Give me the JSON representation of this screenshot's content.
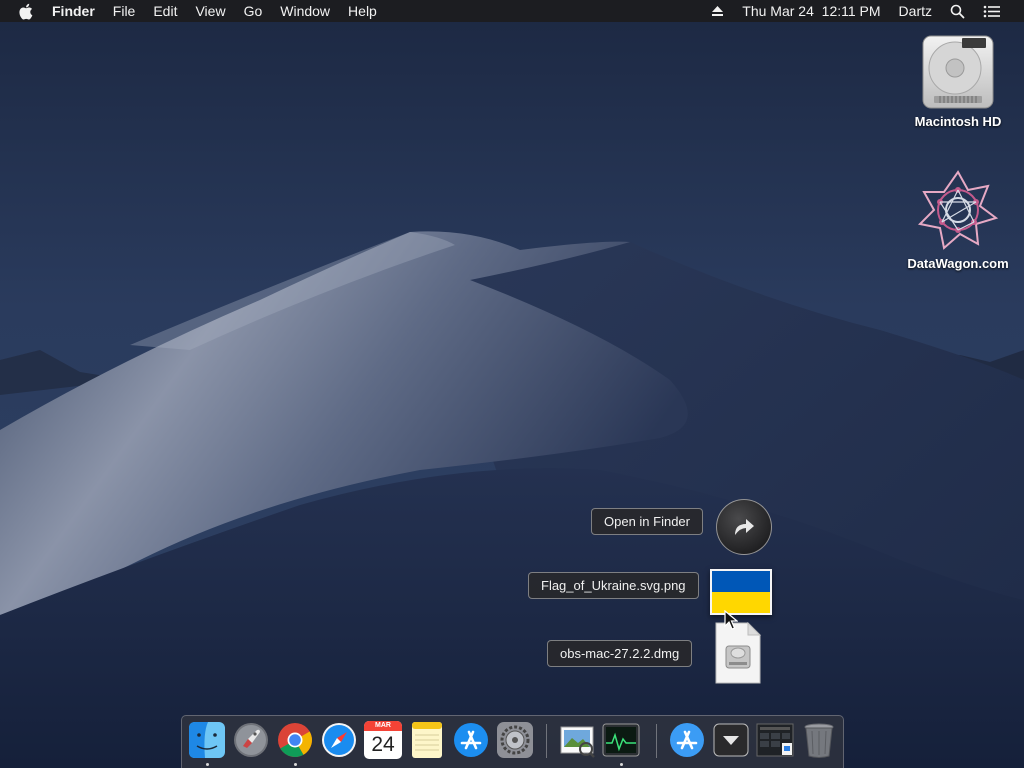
{
  "menubar": {
    "app_name": "Finder",
    "menus": [
      "File",
      "Edit",
      "View",
      "Go",
      "Window",
      "Help"
    ],
    "status": {
      "datetime": "Thu Mar 24  12:11 PM",
      "user": "Dartz"
    }
  },
  "desktop_icons": [
    {
      "label": "Macintosh HD",
      "icon": "hard-drive-icon"
    },
    {
      "label": "DataWagon.com",
      "icon": "datawagon-logo-icon"
    }
  ],
  "stack_fan": {
    "open_label": "Open in Finder",
    "files": [
      {
        "name": "Flag_of_Ukraine.svg.png",
        "icon": "image-thumbnail"
      },
      {
        "name": "obs-mac-27.2.2.dmg",
        "icon": "disk-image-icon"
      }
    ]
  },
  "dock": {
    "calendar": {
      "month": "MAR",
      "day": "24"
    }
  },
  "colors": {
    "menubar_bg": "#1c1c1e",
    "flag_blue": "#0057b7",
    "flag_yellow": "#ffd700"
  }
}
